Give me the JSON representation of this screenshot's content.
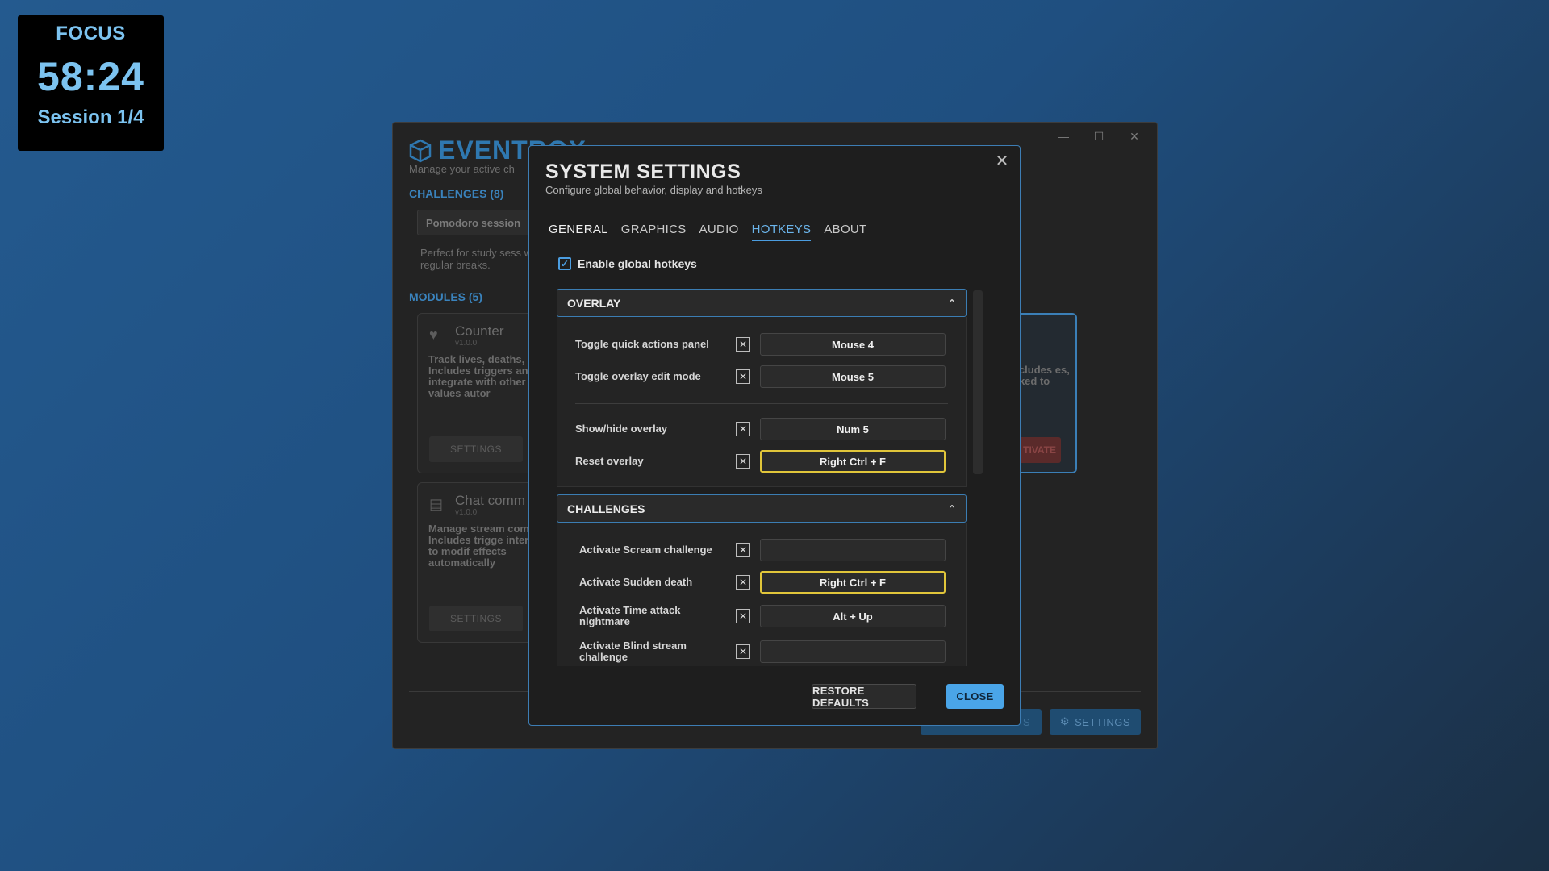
{
  "timer": {
    "label": "FOCUS",
    "time": "58:24",
    "session": "Session 1/4"
  },
  "app": {
    "name": "EVENTBOX",
    "subtitle": "Manage your active ch",
    "challenges_header": "CHALLENGES (8)",
    "challenge_chip": "Pomodoro session",
    "challenge_desc": "Perfect for study sess with regular breaks.",
    "modules_header": "MODULES (5)",
    "modules": [
      {
        "title": "Counter",
        "version": "v1.0.0",
        "desc": "Track lives, deaths, t Includes triggers an integrate with other change values autor",
        "settings": "SETTINGS"
      },
      {
        "title": "Chat comm",
        "version": "v1.0.0",
        "desc": "Manage stream com chat. Includes trigge interaction to modif effects automatically",
        "settings": "SETTINGS"
      }
    ],
    "right_card_desc": "ncludes es, nked to",
    "right_card_btn": "TIVATE",
    "footer_left_btn": "S",
    "footer_settings_btn": "SETTINGS"
  },
  "modal": {
    "title": "SYSTEM SETTINGS",
    "subtitle": "Configure global behavior, display and hotkeys",
    "tabs": [
      "GENERAL",
      "GRAPHICS",
      "AUDIO",
      "HOTKEYS",
      "ABOUT"
    ],
    "active_tab": "HOTKEYS",
    "enable_label": "Enable global hotkeys",
    "enable_checked": true,
    "groups": [
      {
        "name": "OVERLAY",
        "rows": [
          {
            "label": "Toggle quick actions panel",
            "key": "Mouse 4",
            "conflict": false
          },
          {
            "label": "Toggle overlay edit mode",
            "key": "Mouse 5",
            "conflict": false
          },
          {
            "label": "Show/hide overlay",
            "key": "Num 5",
            "conflict": false
          },
          {
            "label": "Reset overlay",
            "key": "Right Ctrl + F",
            "conflict": true
          }
        ]
      },
      {
        "name": "CHALLENGES",
        "rows": [
          {
            "label": "Activate Scream challenge",
            "key": "",
            "conflict": false
          },
          {
            "label": "Activate Sudden death",
            "key": "Right Ctrl + F",
            "conflict": true
          },
          {
            "label": "Activate Time attack nightmare",
            "key": "Alt + Up",
            "conflict": false
          },
          {
            "label": "Activate Blind stream challenge",
            "key": "",
            "conflict": false
          }
        ]
      }
    ],
    "restore_label": "RESTORE DEFAULTS",
    "close_label": "CLOSE"
  },
  "colors": {
    "accent": "#4aa5e8",
    "conflict": "#e0c53a",
    "brand": "#2f78b0"
  }
}
